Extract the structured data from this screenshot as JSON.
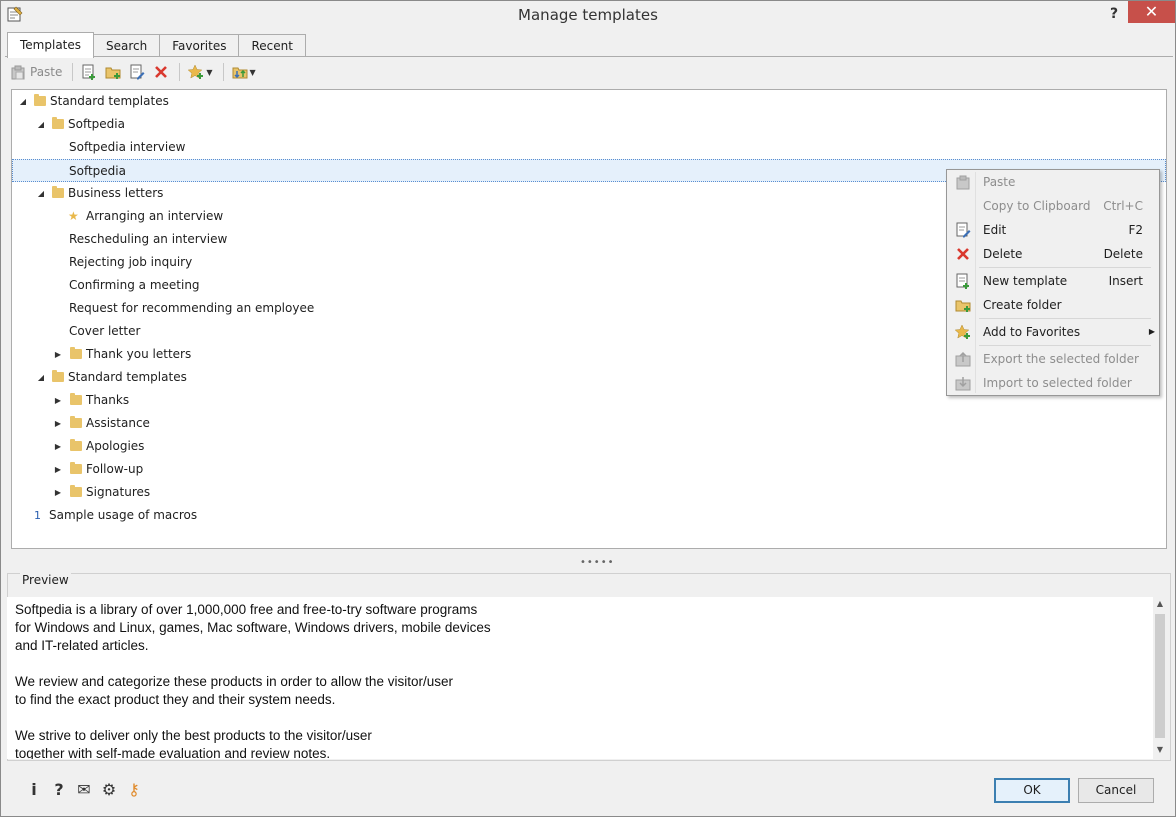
{
  "window": {
    "title": "Manage templates",
    "help_label": "?",
    "close_label": "✕"
  },
  "tabs": [
    {
      "label": "Templates",
      "active": true
    },
    {
      "label": "Search",
      "active": false
    },
    {
      "label": "Favorites",
      "active": false
    },
    {
      "label": "Recent",
      "active": false
    }
  ],
  "toolbar": {
    "paste_label": "Paste"
  },
  "tree": [
    {
      "label": "Standard templates",
      "level": 0,
      "kind": "folder",
      "state": "expanded"
    },
    {
      "label": "Softpedia",
      "level": 1,
      "kind": "folder",
      "state": "expanded"
    },
    {
      "label": "Softpedia interview",
      "level": 2,
      "kind": "item"
    },
    {
      "label": "Softpedia",
      "level": 2,
      "kind": "item",
      "selected": true
    },
    {
      "label": "Business letters",
      "level": 1,
      "kind": "folder",
      "state": "expanded"
    },
    {
      "label": "Arranging an interview",
      "level": 2,
      "kind": "favorite"
    },
    {
      "label": "Rescheduling an interview",
      "level": 2,
      "kind": "item"
    },
    {
      "label": "Rejecting job inquiry",
      "level": 2,
      "kind": "item"
    },
    {
      "label": "Confirming a meeting",
      "level": 2,
      "kind": "item"
    },
    {
      "label": "Request for recommending an employee",
      "level": 2,
      "kind": "item"
    },
    {
      "label": "Cover letter",
      "level": 2,
      "kind": "item"
    },
    {
      "label": "Thank you letters",
      "level": 2,
      "kind": "folder",
      "state": "collapsed"
    },
    {
      "label": "Standard templates",
      "level": 1,
      "kind": "folder",
      "state": "expanded"
    },
    {
      "label": "Thanks",
      "level": 2,
      "kind": "folder",
      "state": "collapsed"
    },
    {
      "label": "Assistance",
      "level": 2,
      "kind": "folder",
      "state": "collapsed"
    },
    {
      "label": "Apologies",
      "level": 2,
      "kind": "folder",
      "state": "collapsed"
    },
    {
      "label": "Follow-up",
      "level": 2,
      "kind": "folder",
      "state": "collapsed"
    },
    {
      "label": "Signatures",
      "level": 2,
      "kind": "folder",
      "state": "collapsed"
    },
    {
      "label": "Sample usage of macros",
      "level": 0,
      "kind": "macro",
      "badge": "1"
    }
  ],
  "splitter_grip": "•••••",
  "preview": {
    "legend": "Preview",
    "text": "Softpedia is a library of over 1,000,000 free and free-to-try software programs\nfor Windows and Linux, games, Mac software, Windows drivers, mobile devices\nand IT-related articles.\n\nWe review and categorize these products in order to allow the visitor/user\nto find the exact product they and their system needs.\n\nWe strive to deliver only the best products to the visitor/user\ntogether with self-made evaluation and review notes."
  },
  "context_menu": {
    "items": [
      {
        "label": "Paste",
        "shortcut": "",
        "disabled": true,
        "icon": "paste-icon"
      },
      {
        "label": "Copy to Clipboard",
        "shortcut": "Ctrl+C",
        "disabled": true,
        "icon": ""
      },
      {
        "label": "Edit",
        "shortcut": "F2",
        "disabled": false,
        "icon": "edit-icon"
      },
      {
        "label": "Delete",
        "shortcut": "Delete",
        "disabled": false,
        "icon": "delete-icon"
      },
      {
        "label": "New template",
        "shortcut": "Insert",
        "disabled": false,
        "icon": "new-template-icon"
      },
      {
        "label": "Create folder",
        "shortcut": "",
        "disabled": false,
        "icon": "create-folder-icon"
      },
      {
        "label": "Add to Favorites",
        "shortcut": "",
        "disabled": false,
        "icon": "favorites-icon",
        "submenu": true
      },
      {
        "label": "Export the selected folder",
        "shortcut": "",
        "disabled": true,
        "icon": "export-icon"
      },
      {
        "label": "Import to selected folder",
        "shortcut": "",
        "disabled": true,
        "icon": "import-icon"
      }
    ]
  },
  "footer": {
    "icons": [
      {
        "name": "info-icon",
        "glyph": "i"
      },
      {
        "name": "help-icon",
        "glyph": "?"
      },
      {
        "name": "mail-icon",
        "glyph": "✉"
      },
      {
        "name": "settings-icon",
        "glyph": "⚙"
      },
      {
        "name": "key-icon",
        "glyph": "⚷"
      }
    ],
    "ok_label": "OK",
    "cancel_label": "Cancel"
  },
  "colors": {
    "folder": "#e9c46a",
    "delete": "#d9382e",
    "ok_border": "#3c7fb1",
    "selection": "#e5f0fb"
  }
}
